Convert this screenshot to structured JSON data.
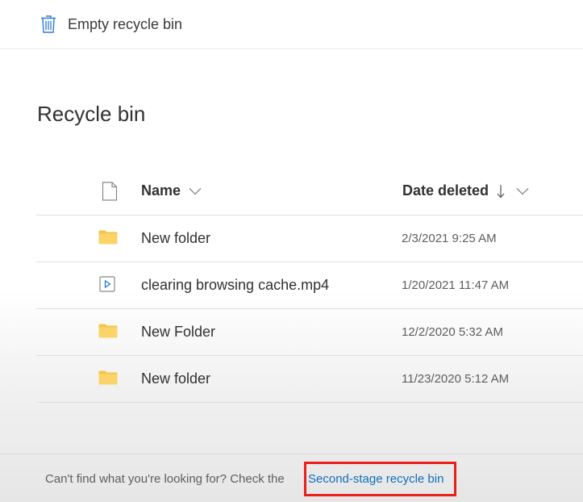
{
  "toolbar": {
    "empty_label": "Empty recycle bin"
  },
  "page": {
    "title": "Recycle bin"
  },
  "list": {
    "columns": {
      "name": "Name",
      "date": "Date deleted"
    },
    "rows": [
      {
        "name": "New folder",
        "date": "2/3/2021 9:25 AM",
        "type": "folder"
      },
      {
        "name": "clearing browsing cache.mp4",
        "date": "1/20/2021 11:47 AM",
        "type": "video"
      },
      {
        "name": "New Folder",
        "date": "12/2/2020 5:32 AM",
        "type": "folder"
      },
      {
        "name": "New folder",
        "date": "11/23/2020 5:12 AM",
        "type": "folder"
      }
    ]
  },
  "footer": {
    "message": "Can't find what you're looking for? Check the",
    "link": "Second-stage recycle bin"
  },
  "colors": {
    "accent": "#106ebe",
    "folder": "#f6c548",
    "highlight": "#e8201a",
    "icon": "#2b7cd3"
  }
}
